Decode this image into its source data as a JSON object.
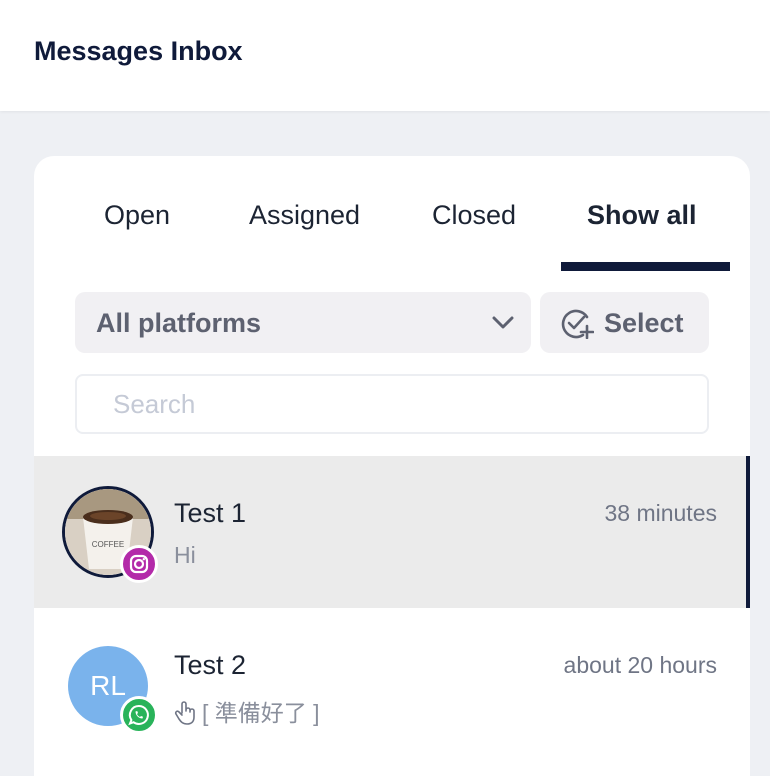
{
  "header": {
    "title": "Messages Inbox"
  },
  "tabs": [
    {
      "label": "Open",
      "active": false
    },
    {
      "label": "Assigned",
      "active": false
    },
    {
      "label": "Closed",
      "active": false
    },
    {
      "label": "Show all",
      "active": true
    }
  ],
  "filters": {
    "platform_label": "All platforms",
    "select_label": "Select",
    "search_placeholder": "Search",
    "search_value": ""
  },
  "conversations": [
    {
      "name": "Test 1",
      "time": "38 minutes",
      "preview": "Hi",
      "platform": "instagram",
      "avatar": "photo",
      "selected": true
    },
    {
      "name": "Test 2",
      "time": "about 20 hours",
      "preview": "[ 準備好了 ]",
      "platform": "whatsapp",
      "avatar_initials": "RL",
      "preview_icon": "hand-pointer-icon",
      "selected": false
    }
  ],
  "colors": {
    "accent": "#0f1a3a",
    "instagram": "#b32aa9",
    "whatsapp": "#29b35a",
    "avatar_bg": "#7ab3ec"
  }
}
